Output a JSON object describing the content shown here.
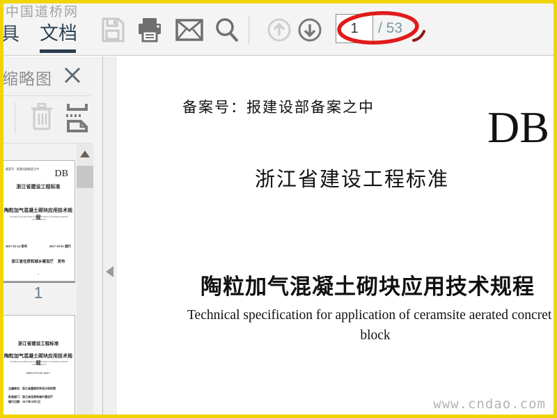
{
  "watermarks": {
    "top_left": "中国道桥网",
    "bottom_right": "www.cndao.com"
  },
  "toolbar": {
    "tab_tools_partial": "具",
    "tab_document_label": "文档",
    "icon_names": [
      "save-icon",
      "print-icon",
      "email-icon",
      "search-icon",
      "page-up-icon",
      "page-down-icon"
    ],
    "page_input_value": "1",
    "page_total_label": "/ 53"
  },
  "sidebar": {
    "panel_title": "缩略图",
    "icon_names": [
      "close-icon",
      "trash-icon",
      "extract-page-icon",
      "scroll-up-icon",
      "collapse-panel-icon"
    ],
    "thumb1": {
      "record_note": "备案号：报建设部备案之中",
      "code": "DB",
      "standard_label": "浙江省建设工程标准",
      "title_cn": "陶粒加气混凝土砌块应用技术规程",
      "title_en": "Technical specification for application of ceramsite aerated concrete block",
      "date_issue": "2017-03-24 发布",
      "date_effective": "2017-10-01 施行",
      "publisher": "浙江省住房和城乡建设厅　发布",
      "page_mark": "1",
      "page_label": "1"
    },
    "thumb2": {
      "standard_label": "浙江省建设工程标准",
      "title_cn": "陶粒加气混凝土砌块应用技术规程",
      "title_en": "Technical specification for application of ceramsite aerated concrete block",
      "code_number": "DB33/T1155-2017",
      "chief_editor": "主编单位：浙江省建筑科学设计研究院",
      "approver": "批准部门：浙江省住房和城乡建设厅",
      "effective_date": "施行日期：2017年10月1日"
    }
  },
  "document": {
    "record_note": "备案号：报建设部备案之中",
    "code": "DB",
    "standard_label": "浙江省建设工程标准",
    "title_cn": "陶粒加气混凝土砌块应用技术规程",
    "title_en_line1": "Technical specification for application of ceramsite aerated concret",
    "title_en_line2": "block"
  },
  "colors": {
    "frame_border": "#f0d500",
    "accent_tab": "#2b3c4e",
    "annotation_red": "#e11b1b",
    "page_total_text": "#7d95a6"
  }
}
